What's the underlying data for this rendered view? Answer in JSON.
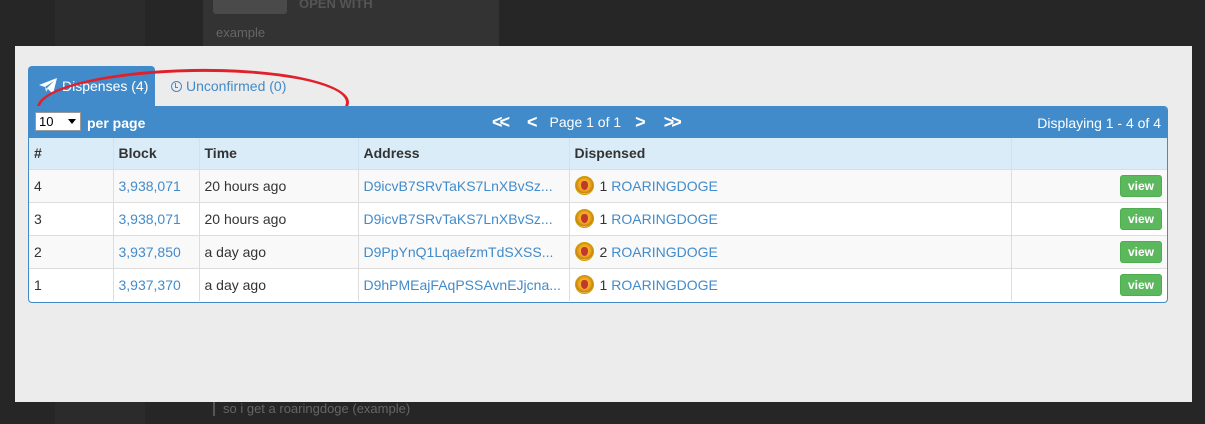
{
  "background": {
    "left_label": "...",
    "panel_open_with": "OPEN WITH",
    "panel_example": "example",
    "bottom_text": "so i get a roaringdoge (example)"
  },
  "tabs": [
    {
      "label": "Dispenses (4)",
      "icon": "paper-plane-icon",
      "active": true
    },
    {
      "label": "Unconfirmed (0)",
      "icon": "clock-icon",
      "active": false
    }
  ],
  "toolbar": {
    "per_page_value": "10",
    "per_page_label": "per page",
    "first": "<<",
    "prev": "<",
    "page_info": "Page 1 of 1",
    "next": ">",
    "last": ">>",
    "displaying": "Displaying 1 - 4 of 4"
  },
  "table": {
    "headers": [
      "#",
      "Block",
      "Time",
      "Address",
      "Dispensed",
      ""
    ],
    "rows": [
      {
        "num": "4",
        "block": "3,938,071",
        "time": "20 hours ago",
        "address": "D9icvB7SRvTaKS7LnXBvSz...",
        "qty": "1",
        "asset": "ROARINGDOGE",
        "action": "view"
      },
      {
        "num": "3",
        "block": "3,938,071",
        "time": "20 hours ago",
        "address": "D9icvB7SRvTaKS7LnXBvSz...",
        "qty": "1",
        "asset": "ROARINGDOGE",
        "action": "view"
      },
      {
        "num": "2",
        "block": "3,937,850",
        "time": "a day ago",
        "address": "D9PpYnQ1LqaefzmTdSXSS...",
        "qty": "2",
        "asset": "ROARINGDOGE",
        "action": "view"
      },
      {
        "num": "1",
        "block": "3,937,370",
        "time": "a day ago",
        "address": "D9hPMEajFAqPSSAvnEJjcna...",
        "qty": "1",
        "asset": "ROARINGDOGE",
        "action": "view"
      }
    ]
  },
  "colors": {
    "primary": "#428bca",
    "success": "#5cb85c",
    "annotation": "#e0202a"
  }
}
